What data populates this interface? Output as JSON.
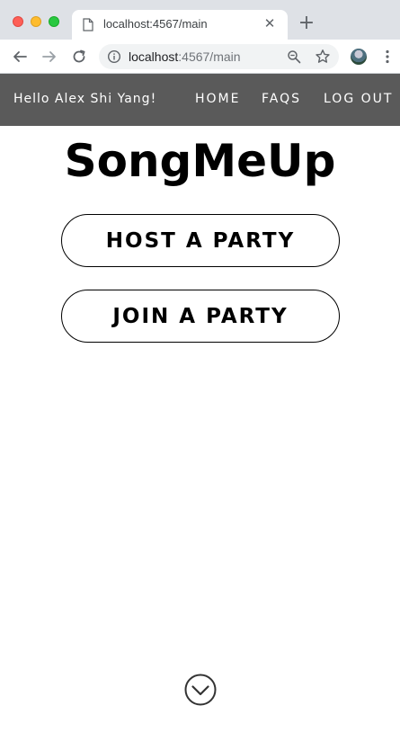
{
  "browser": {
    "tab": {
      "title": "localhost:4567/main",
      "icon": "document-icon",
      "close_glyph": "✕"
    },
    "new_tab_glyph": "+",
    "url": {
      "host": "localhost",
      "path": ":4567/main"
    },
    "icons": [
      "back-icon",
      "forward-icon",
      "reload-icon",
      "info-icon",
      "zoom-icon",
      "star-icon",
      "profile-avatar",
      "menu-dots-icon"
    ]
  },
  "site_nav": {
    "greeting": "Hello Alex Shi Yang!",
    "links": [
      {
        "label": "HOME"
      },
      {
        "label": "FAQS"
      },
      {
        "label": "LOG OUT"
      }
    ]
  },
  "main": {
    "title": "SongMeUp",
    "host_button": "HOST A PARTY",
    "join_button": "JOIN A PARTY",
    "scroll_icon": "chevron-down-circle-icon"
  },
  "colors": {
    "nav_bg": "#5a5a5a",
    "nav_text": "#ffffff",
    "title": "#000000",
    "button_border": "#000000"
  }
}
